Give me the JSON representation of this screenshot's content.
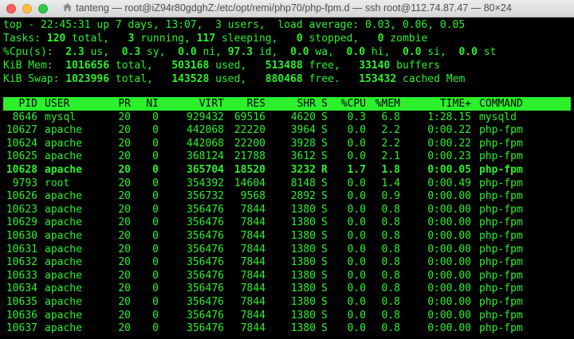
{
  "window": {
    "title": "tanteng — root@iZ94r80gdghZ:/etc/opt/remi/php70/php-fpm.d — ssh root@112.74.87.47 — 80×24"
  },
  "summary": {
    "uptime_line": "top - 22:45:31 up 7 days, 13:07,  3 users,  load average: 0.03, 0.06, 0.05",
    "tasks": {
      "label": "Tasks: ",
      "total": "120",
      "total_label": " total,   ",
      "running": "3",
      "running_label": " running, ",
      "sleeping": "117",
      "sleeping_label": " sleeping,   ",
      "stopped": "0",
      "stopped_label": " stopped,   ",
      "zombie": "0",
      "zombie_label": " zombie"
    },
    "cpu": {
      "label": "%Cpu(s):  ",
      "us": "2.3",
      "us_label": " us,  ",
      "sy": "0.3",
      "sy_label": " sy,  ",
      "ni": "0.0",
      "ni_label": " ni, ",
      "id": "97.3",
      "id_label": " id,  ",
      "wa": "0.0",
      "wa_label": " wa,  ",
      "hi": "0.0",
      "hi_label": " hi,  ",
      "si": "0.0",
      "si_label": " si,  ",
      "st": "0.0",
      "st_label": " st"
    },
    "mem": {
      "label": "KiB Mem:  ",
      "total": "1016656",
      "total_label": " total,   ",
      "used": "503168",
      "used_label": " used,   ",
      "free": "513488",
      "free_label": " free,   ",
      "buffers": "33140",
      "buffers_label": " buffers"
    },
    "swap": {
      "label": "KiB Swap: ",
      "total": "1023996",
      "total_label": " total,   ",
      "used": "143528",
      "used_label": " used,   ",
      "free": "880468",
      "free_label": " free.   ",
      "cached": "153432",
      "cached_label": " cached Mem"
    }
  },
  "table": {
    "columns": [
      "PID",
      "USER",
      "PR",
      "NI",
      "VIRT",
      "RES",
      "SHR",
      "S",
      "%CPU",
      "%MEM",
      "TIME+",
      "COMMAND"
    ],
    "rows": [
      [
        "8646",
        "mysql",
        "20",
        "0",
        "929432",
        "69516",
        "4620",
        "S",
        "0.3",
        "6.8",
        "1:28.15",
        "mysqld"
      ],
      [
        "10627",
        "apache",
        "20",
        "0",
        "442068",
        "22220",
        "3964",
        "S",
        "0.0",
        "2.2",
        "0:00.22",
        "php-fpm"
      ],
      [
        "10624",
        "apache",
        "20",
        "0",
        "442068",
        "22200",
        "3928",
        "S",
        "0.0",
        "2.2",
        "0:00.22",
        "php-fpm"
      ],
      [
        "10625",
        "apache",
        "20",
        "0",
        "368124",
        "21788",
        "3612",
        "S",
        "0.0",
        "2.1",
        "0:00.23",
        "php-fpm"
      ],
      [
        "10628",
        "apache",
        "20",
        "0",
        "365704",
        "18520",
        "3232",
        "R",
        "1.7",
        "1.8",
        "0:00.05",
        "php-fpm"
      ],
      [
        "9793",
        "root",
        "20",
        "0",
        "354392",
        "14604",
        "8148",
        "S",
        "0.0",
        "1.4",
        "0:00.49",
        "php-fpm"
      ],
      [
        "10626",
        "apache",
        "20",
        "0",
        "356732",
        "9568",
        "2892",
        "S",
        "0.0",
        "0.9",
        "0:00.00",
        "php-fpm"
      ],
      [
        "10623",
        "apache",
        "20",
        "0",
        "356476",
        "7844",
        "1380",
        "S",
        "0.0",
        "0.8",
        "0:00.00",
        "php-fpm"
      ],
      [
        "10629",
        "apache",
        "20",
        "0",
        "356476",
        "7844",
        "1380",
        "S",
        "0.0",
        "0.8",
        "0:00.00",
        "php-fpm"
      ],
      [
        "10630",
        "apache",
        "20",
        "0",
        "356476",
        "7844",
        "1380",
        "S",
        "0.0",
        "0.8",
        "0:00.00",
        "php-fpm"
      ],
      [
        "10631",
        "apache",
        "20",
        "0",
        "356476",
        "7844",
        "1380",
        "S",
        "0.0",
        "0.8",
        "0:00.00",
        "php-fpm"
      ],
      [
        "10632",
        "apache",
        "20",
        "0",
        "356476",
        "7844",
        "1380",
        "S",
        "0.0",
        "0.8",
        "0:00.00",
        "php-fpm"
      ],
      [
        "10633",
        "apache",
        "20",
        "0",
        "356476",
        "7844",
        "1380",
        "S",
        "0.0",
        "0.8",
        "0:00.00",
        "php-fpm"
      ],
      [
        "10634",
        "apache",
        "20",
        "0",
        "356476",
        "7844",
        "1380",
        "S",
        "0.0",
        "0.8",
        "0:00.00",
        "php-fpm"
      ],
      [
        "10635",
        "apache",
        "20",
        "0",
        "356476",
        "7844",
        "1380",
        "S",
        "0.0",
        "0.8",
        "0:00.00",
        "php-fpm"
      ],
      [
        "10636",
        "apache",
        "20",
        "0",
        "356476",
        "7844",
        "1380",
        "S",
        "0.0",
        "0.8",
        "0:00.00",
        "php-fpm"
      ],
      [
        "10637",
        "apache",
        "20",
        "0",
        "356476",
        "7844",
        "1380",
        "S",
        "0.0",
        "0.8",
        "0:00.00",
        "php-fpm"
      ]
    ],
    "highlighted_pid": "10628"
  },
  "colors": {
    "terminal_bg": "#000000",
    "terminal_fg": "#2bf02b",
    "header_bar_bg": "#2bf02b",
    "header_bar_fg": "#000000"
  }
}
